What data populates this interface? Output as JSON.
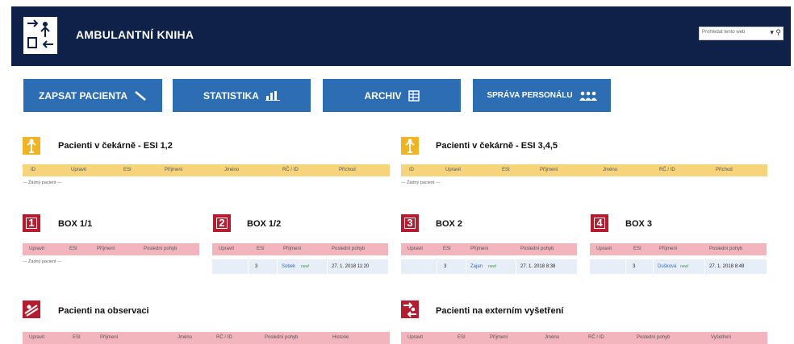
{
  "app": {
    "title": "AMBULANTNÍ KNIHA",
    "search_placeholder": "Prohledat tento web"
  },
  "buttons": {
    "zapsat": "ZAPSAT PACIENTA",
    "statistika": "STATISTIKA",
    "archiv": "ARCHIV",
    "sprava": "SPRÁVA PERSONÁLU"
  },
  "colors": {
    "header": "#0f2149",
    "button": "#2c6db3",
    "yellow": "#f5d47b",
    "pink": "#f2b5bd",
    "box_red": "#b51c2f"
  },
  "waiting_12": {
    "title": "Pacienti v čekárně - ESI 1,2",
    "columns": [
      "ID",
      "Upravit",
      "ESI",
      "Příjmení",
      "Jméno",
      "RČ / ID",
      "Příchod"
    ],
    "empty": "--- Žádný pacient ---"
  },
  "waiting_345": {
    "title": "Pacienti v čekárně - ESI 3,4,5",
    "columns": [
      "ID",
      "Upravit",
      "ESI",
      "Příjmení",
      "Jméno",
      "RČ / ID",
      "Příchod"
    ],
    "empty": "--- Žádný pacient ---"
  },
  "boxes": [
    {
      "num": "1",
      "title": "BOX 1/1",
      "columns": [
        "Upravit",
        "ESI",
        "Příjmení",
        "Poslední pohyb"
      ],
      "empty": "--- Žádný pacient ---"
    },
    {
      "num": "2",
      "title": "BOX 1/2",
      "columns": [
        "Upravit",
        "ESI",
        "Příjmení",
        "Poslední pohyb"
      ],
      "row": {
        "esi": "3",
        "name": "Sobek",
        "tag": "new!",
        "time": "27. 1. 2018 11:20"
      }
    },
    {
      "num": "3",
      "title": "BOX 2",
      "columns": [
        "Upravit",
        "ESI",
        "Příjmení",
        "Poslední pohyb"
      ],
      "row": {
        "esi": "3",
        "name": "Zajan",
        "tag": "new!",
        "time": "27. 1. 2018 8:38"
      }
    },
    {
      "num": "4",
      "title": "BOX 3",
      "columns": [
        "Upravit",
        "ESI",
        "Příjmení",
        "Poslední pohyb"
      ],
      "row": {
        "esi": "3",
        "name": "Dušková",
        "tag": "new!",
        "time": "27. 1. 2018 8:49"
      }
    }
  ],
  "observation": {
    "title": "Pacienti na observaci",
    "columns": [
      "Upravit",
      "ESI",
      "Příjmení",
      "Jméno",
      "RČ / ID",
      "Poslední pohyb",
      "Historie"
    ]
  },
  "external": {
    "title": "Pacienti na externím vyšetření",
    "columns": [
      "Upravit",
      "ESI",
      "Příjmení",
      "Jméno",
      "RČ / ID",
      "Poslední pohyb",
      "Vyšetření"
    ]
  },
  "icons": [
    "app-logo-icon",
    "pen-icon",
    "bar-chart-icon",
    "grid-icon",
    "people-icon",
    "arrow-up-person-icon",
    "box-number-icon",
    "bed-icon",
    "transfer-icon",
    "search-icon"
  ]
}
